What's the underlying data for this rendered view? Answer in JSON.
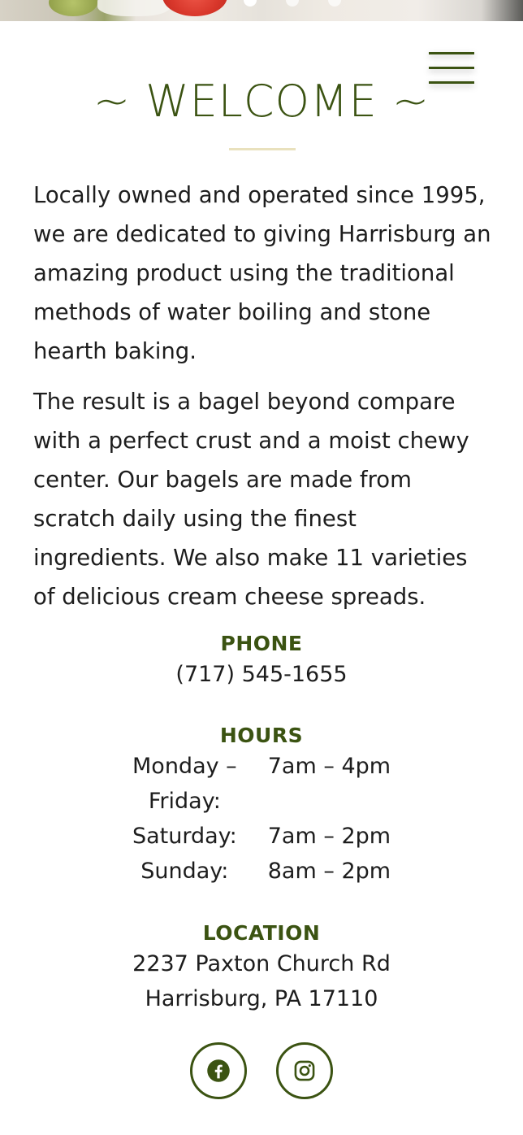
{
  "header": {
    "menu_icon": "hamburger-icon",
    "carousel_dots": 3,
    "carousel_active_index": 0
  },
  "welcome": {
    "title": "~ WELCOME ~",
    "paragraphs": [
      "Locally owned and operated since 1995, we are dedicated to giving Harrisburg an amazing product using the traditional methods of water boiling and stone hearth baking.",
      "The result is a bagel beyond compare with a perfect crust and a moist chewy center. Our bagels are made from scratch daily using the finest ingredients. We also make 11 varieties of delicious cream cheese spreads."
    ]
  },
  "phone": {
    "label": "PHONE",
    "value": "(717) 545-1655"
  },
  "hours": {
    "label": "HOURS",
    "rows": [
      {
        "day": "Monday – Friday:",
        "time": "7am – 4pm"
      },
      {
        "day": "Saturday:",
        "time": "7am – 2pm"
      },
      {
        "day": "Sunday:",
        "time": "8am – 2pm"
      }
    ]
  },
  "location": {
    "label": "LOCATION",
    "line1": "2237 Paxton Church Rd",
    "line2": "Harrisburg, PA 17110"
  },
  "social": {
    "icons": [
      "facebook-icon",
      "instagram-icon"
    ]
  },
  "colors": {
    "brand_green": "#3b5312",
    "rule_cream": "#e9e1bd",
    "text": "#1d1d1d"
  }
}
